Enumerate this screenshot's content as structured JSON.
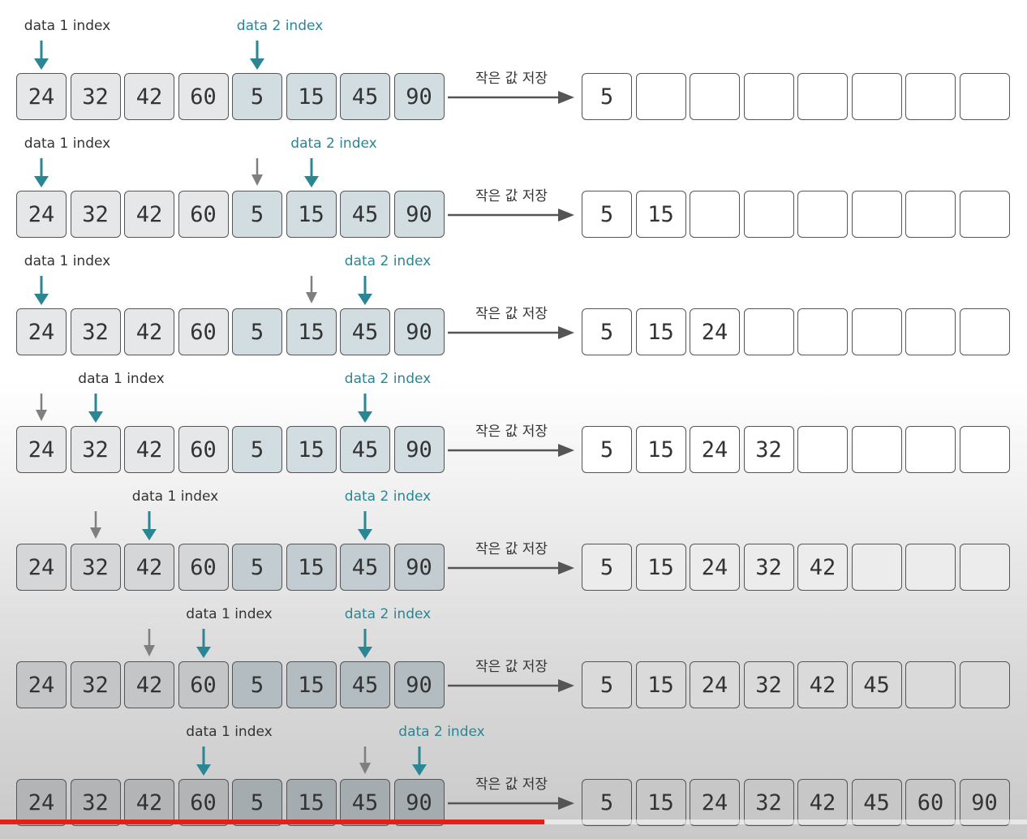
{
  "left_array": [
    24,
    32,
    42,
    60,
    5,
    15,
    45,
    90
  ],
  "split_index": 4,
  "output_slots": 8,
  "caption": "작은 값 저장",
  "data1_label": "data 1 index",
  "data2_label": "data 2 index",
  "colors": {
    "data1_pointer": "#2a8693",
    "data2_pointer": "#2a8693",
    "previous_pointer": "#7f7f7f",
    "left_half_fill": "#e6e7e9",
    "right_half_fill": "#d2dde2",
    "border": "#555555",
    "progress": "#e32119"
  },
  "icons": {
    "pointer": "down-arrow-icon",
    "flow": "right-arrow-icon"
  },
  "steps": [
    {
      "d1": 0,
      "d2": 4,
      "prev": null,
      "result": [
        5
      ]
    },
    {
      "d1": 0,
      "d2": 5,
      "prev": 4,
      "result": [
        5,
        15
      ]
    },
    {
      "d1": 0,
      "d2": 6,
      "prev": 5,
      "result": [
        5,
        15,
        24
      ]
    },
    {
      "d1": 1,
      "d2": 6,
      "prev": 0,
      "result": [
        5,
        15,
        24,
        32
      ]
    },
    {
      "d1": 2,
      "d2": 6,
      "prev": 1,
      "result": [
        5,
        15,
        24,
        32,
        42
      ]
    },
    {
      "d1": 3,
      "d2": 6,
      "prev": 2,
      "result": [
        5,
        15,
        24,
        32,
        42,
        45
      ]
    },
    {
      "d1": 3,
      "d2": 7,
      "prev": 6,
      "result": [
        5,
        15,
        24,
        32,
        42,
        45,
        60,
        90
      ]
    }
  ],
  "video_progress": 0.53
}
